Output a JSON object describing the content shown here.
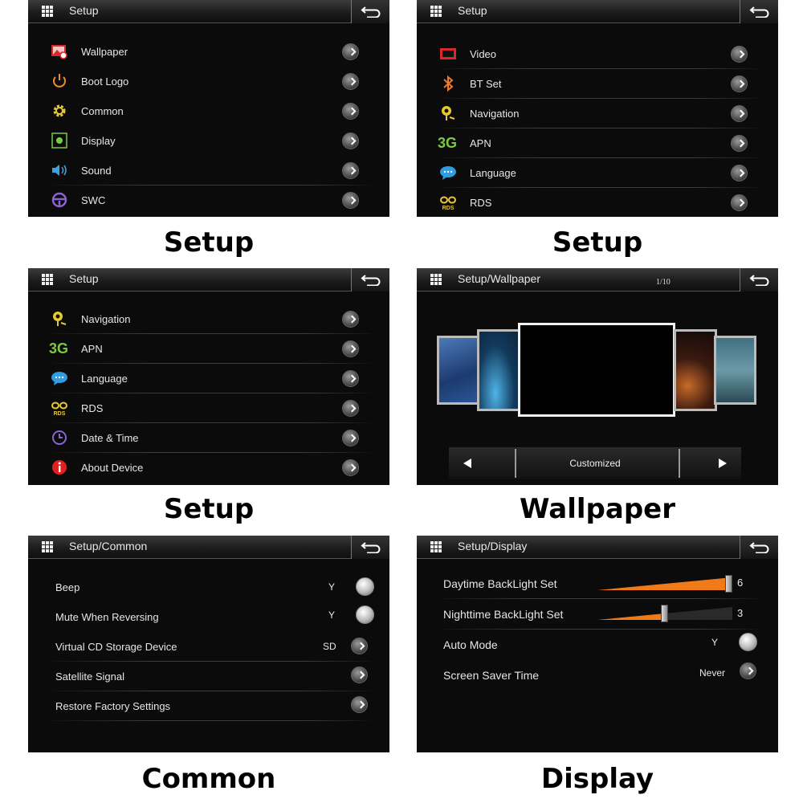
{
  "panels": {
    "setup1": {
      "title": "Setup",
      "items": [
        {
          "label": "Wallpaper",
          "icon": "wallpaper-icon"
        },
        {
          "label": "Boot Logo",
          "icon": "power-icon"
        },
        {
          "label": "Common",
          "icon": "gear-icon"
        },
        {
          "label": "Display",
          "icon": "display-icon"
        },
        {
          "label": "Sound",
          "icon": "speaker-icon"
        },
        {
          "label": "SWC",
          "icon": "steering-wheel-icon"
        }
      ]
    },
    "setup2": {
      "title": "Setup",
      "items": [
        {
          "label": "Video",
          "icon": "video-icon"
        },
        {
          "label": "BT Set",
          "icon": "bluetooth-icon"
        },
        {
          "label": "Navigation",
          "icon": "navigation-icon"
        },
        {
          "label": "APN",
          "icon": "3g-icon",
          "icon_text": "3G"
        },
        {
          "label": "Language",
          "icon": "language-icon"
        },
        {
          "label": "RDS",
          "icon": "rds-icon",
          "icon_text": "RDS"
        }
      ]
    },
    "setup3": {
      "title": "Setup",
      "items": [
        {
          "label": "Navigation",
          "icon": "navigation-icon"
        },
        {
          "label": "APN",
          "icon": "3g-icon",
          "icon_text": "3G"
        },
        {
          "label": "Language",
          "icon": "language-icon"
        },
        {
          "label": "RDS",
          "icon": "rds-icon",
          "icon_text": "RDS"
        },
        {
          "label": "Date & Time",
          "icon": "clock-icon"
        },
        {
          "label": "About Device",
          "icon": "info-icon"
        }
      ]
    },
    "wallpaper": {
      "title": "Setup/Wallpaper",
      "pager": "1/10",
      "selected": "Customized"
    },
    "common": {
      "title": "Setup/Common",
      "items": [
        {
          "label": "Beep",
          "value": "Y"
        },
        {
          "label": "Mute When Reversing",
          "value": "Y"
        },
        {
          "label": "Virtual CD Storage Device",
          "value": "SD"
        },
        {
          "label": "Satellite Signal",
          "value": ""
        },
        {
          "label": "Restore Factory Settings",
          "value": ""
        }
      ]
    },
    "display": {
      "title": "Setup/Display",
      "items": [
        {
          "label": "Daytime BackLight Set",
          "value": "6",
          "level": 6,
          "max": 6
        },
        {
          "label": "Nighttime BackLight Set",
          "value": "3",
          "level": 3,
          "max": 6
        },
        {
          "label": "Auto Mode",
          "value": "Y"
        },
        {
          "label": "Screen Saver Time",
          "value": "Never"
        }
      ]
    }
  },
  "captions": [
    "Setup",
    "Setup",
    "Setup",
    "Wallpaper",
    "Common",
    "Display"
  ],
  "colors": {
    "accent": "#f07a18",
    "background": "#0c0b0b",
    "text": "#e6e6e6"
  }
}
